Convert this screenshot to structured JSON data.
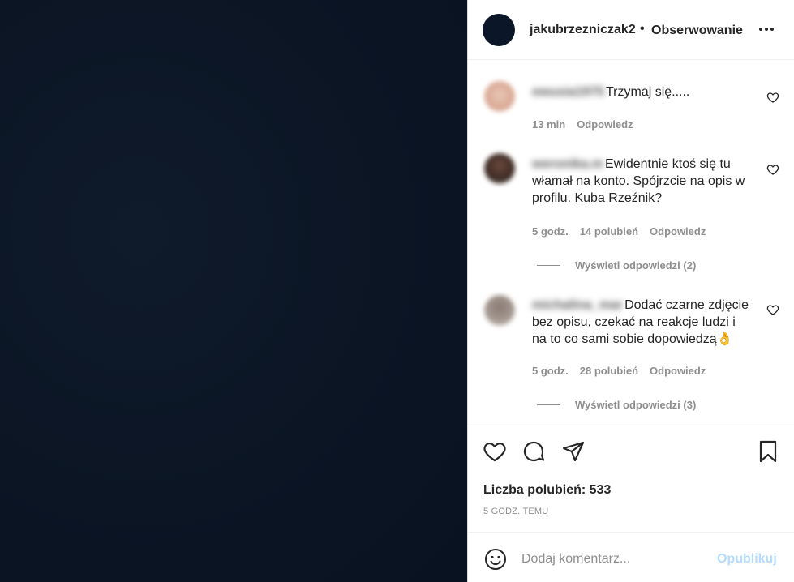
{
  "post": {
    "username": "jakubrzezniczak2",
    "separator": "•",
    "follow_label": "Obserwowanie"
  },
  "comments": [
    {
      "user": "ewusia1975",
      "text": "Trzymaj się.....",
      "time": "13 min",
      "likes": "",
      "reply_label": "Odpowiedz",
      "view_replies": ""
    },
    {
      "user": "weronika.m",
      "text": "Ewidentnie ktoś się tu włamał na konto. Spójrzcie na opis w profilu. Kuba Rzeźnik?",
      "time": "5 godz.",
      "likes": "14 polubień",
      "reply_label": "Odpowiedz",
      "view_replies": "Wyświetl odpowiedzi (2)"
    },
    {
      "user": "michalina_mar",
      "text": "Dodać czarne zdjęcie bez opisu, czekać na reakcje ludzi i na to co sami sobie dopowiedzą👌",
      "time": "5 godz.",
      "likes": "28 polubień",
      "reply_label": "Odpowiedz",
      "view_replies": "Wyświetl odpowiedzi (3)"
    }
  ],
  "stats": {
    "likes_text": "Liczba polubień: 533",
    "posted": "5 GODZ. TEMU"
  },
  "add_comment": {
    "placeholder": "Dodaj komentarz...",
    "publish_label": "Opublikuj"
  },
  "icons": {
    "more": "more-horizontal-icon",
    "heart": "heart-icon",
    "comment": "comment-icon",
    "share": "paper-plane-icon",
    "save": "bookmark-icon",
    "emoji": "emoji-icon"
  },
  "colors": {
    "photo": "#0b1524",
    "publish_disabled": "#b3dbff",
    "secondary_text": "#8e8e8e"
  }
}
